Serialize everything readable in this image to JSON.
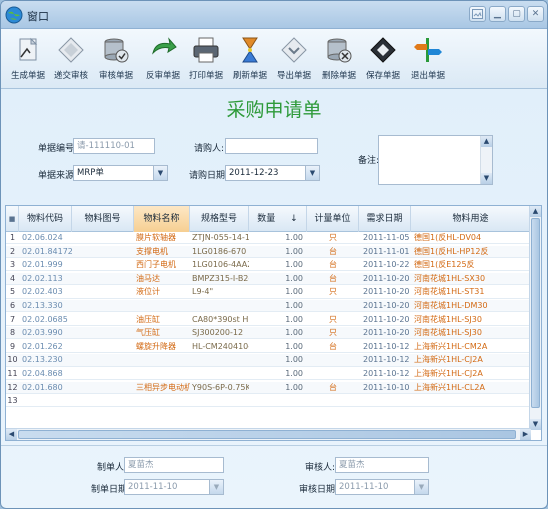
{
  "window": {
    "title": "窗口"
  },
  "toolbar": {
    "items": [
      {
        "label": "生成单据",
        "icon": "generate-doc-icon"
      },
      {
        "label": "递交审核",
        "icon": "submit-review-icon"
      },
      {
        "label": "审核单据",
        "icon": "review-doc-icon"
      },
      {
        "label": "反审单据",
        "icon": "reverse-review-icon"
      },
      {
        "label": "打印单据",
        "icon": "print-icon"
      },
      {
        "label": "刷新单据",
        "icon": "refresh-icon"
      },
      {
        "label": "导出单据",
        "icon": "export-icon"
      },
      {
        "label": "删除单据",
        "icon": "delete-icon"
      },
      {
        "label": "保存单据",
        "icon": "save-icon"
      },
      {
        "label": "退出单据",
        "icon": "exit-icon"
      }
    ]
  },
  "form": {
    "title": "采购申请单",
    "doc_no_label": "单据编号:",
    "doc_no_value": "请-111110-01",
    "requester_label": "请购人:",
    "requester_value": "",
    "remark_label": "备注:",
    "source_label": "单据来源:",
    "source_value": "MRP单",
    "date_label": "请购日期:",
    "date_value": "2011-12-23"
  },
  "grid": {
    "columns": [
      "物料代码",
      "物料图号",
      "物料名称",
      "规格型号",
      "数量",
      "计量单位",
      "需求日期",
      "物料用途"
    ],
    "sort_indicator": "↓",
    "rows": [
      {
        "n": "1",
        "code": "02.06.024",
        "drawing": "",
        "name": "膜片软轴器",
        "spec": "ZTJN-055-14-15",
        "qty": "1.00",
        "unit": "只",
        "date": "2011-11-05",
        "use": "德国1(反HL-DV04"
      },
      {
        "n": "2",
        "code": "02.01.84172",
        "drawing": "",
        "name": "支撑电机",
        "spec": "1LG0186-670 15",
        "qty": "1.00",
        "unit": "台",
        "date": "2011-11-01",
        "use": "德国1(反HL-HP12反"
      },
      {
        "n": "3",
        "code": "02.01.999",
        "drawing": "",
        "name": "西门子电机",
        "spec": "1LG0106-4AA21-",
        "qty": "1.00",
        "unit": "台",
        "date": "2011-10-22",
        "use": "德国1(反E125反"
      },
      {
        "n": "4",
        "code": "02.02.113",
        "drawing": "",
        "name": "油马达",
        "spec": "BMPZ315-I-B2-T",
        "qty": "1.00",
        "unit": "台",
        "date": "2011-10-20",
        "use": "河南花城1HL-SX30"
      },
      {
        "n": "5",
        "code": "02.02.403",
        "drawing": "",
        "name": "液位计",
        "spec": "L9-4\"",
        "qty": "1.00",
        "unit": "只",
        "date": "2011-10-20",
        "use": "河南花城1HL-ST31"
      },
      {
        "n": "6",
        "code": "02.13.330",
        "drawing": "",
        "name": "",
        "spec": "",
        "qty": "1.00",
        "unit": "",
        "date": "2011-10-20",
        "use": "河南花城1HL-DM30"
      },
      {
        "n": "7",
        "code": "02.02.0685",
        "drawing": "",
        "name": "油压缸",
        "spec": "CA80*390st HL-",
        "qty": "1.00",
        "unit": "只",
        "date": "2011-10-20",
        "use": "河南花城1HL-SJ30"
      },
      {
        "n": "8",
        "code": "02.03.990",
        "drawing": "",
        "name": "气压缸",
        "spec": "SJ300200-12",
        "qty": "1.00",
        "unit": "只",
        "date": "2011-10-20",
        "use": "河南花城1HL-SJ30"
      },
      {
        "n": "9",
        "code": "02.01.262",
        "drawing": "",
        "name": "螺旋升降器",
        "spec": "HL-CM240410-00",
        "qty": "1.00",
        "unit": "台",
        "date": "2011-10-12",
        "use": "上海新兴1HL-CM2A"
      },
      {
        "n": "10",
        "code": "02.13.230",
        "drawing": "",
        "name": "",
        "spec": "",
        "qty": "1.00",
        "unit": "",
        "date": "2011-10-12",
        "use": "上海新兴1HL-CJ2A"
      },
      {
        "n": "11",
        "code": "02.04.868",
        "drawing": "",
        "name": "",
        "spec": "",
        "qty": "1.00",
        "unit": "",
        "date": "2011-10-12",
        "use": "上海新兴1HL-CJ2A"
      },
      {
        "n": "12",
        "code": "02.01.680",
        "drawing": "",
        "name": "三相异步电动机",
        "spec": "Y90S-6P-0.75KW",
        "qty": "1.00",
        "unit": "台",
        "date": "2011-10-10",
        "use": "上海新兴1HL-CL2A"
      },
      {
        "n": "13",
        "code": "",
        "drawing": "",
        "name": "",
        "spec": "",
        "qty": "",
        "unit": "",
        "date": "",
        "use": ""
      }
    ]
  },
  "footer": {
    "maker_label": "制单人:",
    "maker_value": "夏苗杰",
    "reviewer_label": "审核人:",
    "reviewer_value": "夏苗杰",
    "make_date_label": "制单日期:",
    "make_date_value": "2011-11-10",
    "review_date_label": "审核日期:",
    "review_date_value": "2011-11-10"
  }
}
